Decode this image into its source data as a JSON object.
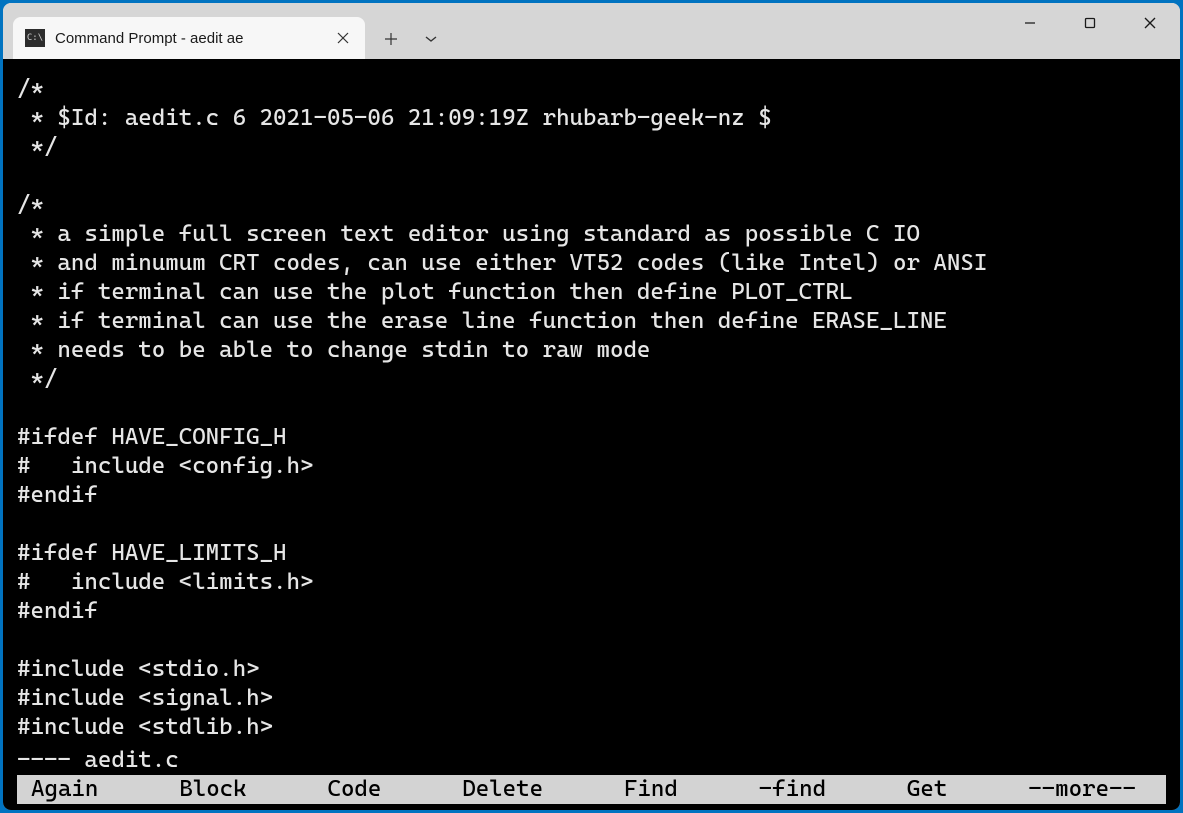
{
  "window": {
    "tab_title": "Command Prompt - aedit  ae",
    "controls": {
      "minimize": "minimize",
      "maximize": "maximize",
      "close": "close"
    }
  },
  "terminal": {
    "lines": [
      "/*",
      " * $Id: aedit.c 6 2021-05-06 21:09:19Z rhubarb-geek-nz $",
      " */",
      "",
      "/*",
      " * a simple full screen text editor using standard as possible C IO",
      " * and minumum CRT codes, can use either VT52 codes (like Intel) or ANSI",
      " * if terminal can use the plot function then define PLOT_CTRL",
      " * if terminal can use the erase line function then define ERASE_LINE",
      " * needs to be able to change stdin to raw mode",
      " */",
      "",
      "#ifdef HAVE_CONFIG_H",
      "#   include <config.h>",
      "#endif",
      "",
      "#ifdef HAVE_LIMITS_H",
      "#   include <limits.h>",
      "#endif",
      "",
      "#include <stdio.h>",
      "#include <signal.h>",
      "#include <stdlib.h>"
    ],
    "status": " ---- aedit.c",
    "menu": [
      "Again",
      "Block",
      "Code",
      "Delete",
      "Find",
      "-find",
      "Get",
      "--more--"
    ]
  }
}
